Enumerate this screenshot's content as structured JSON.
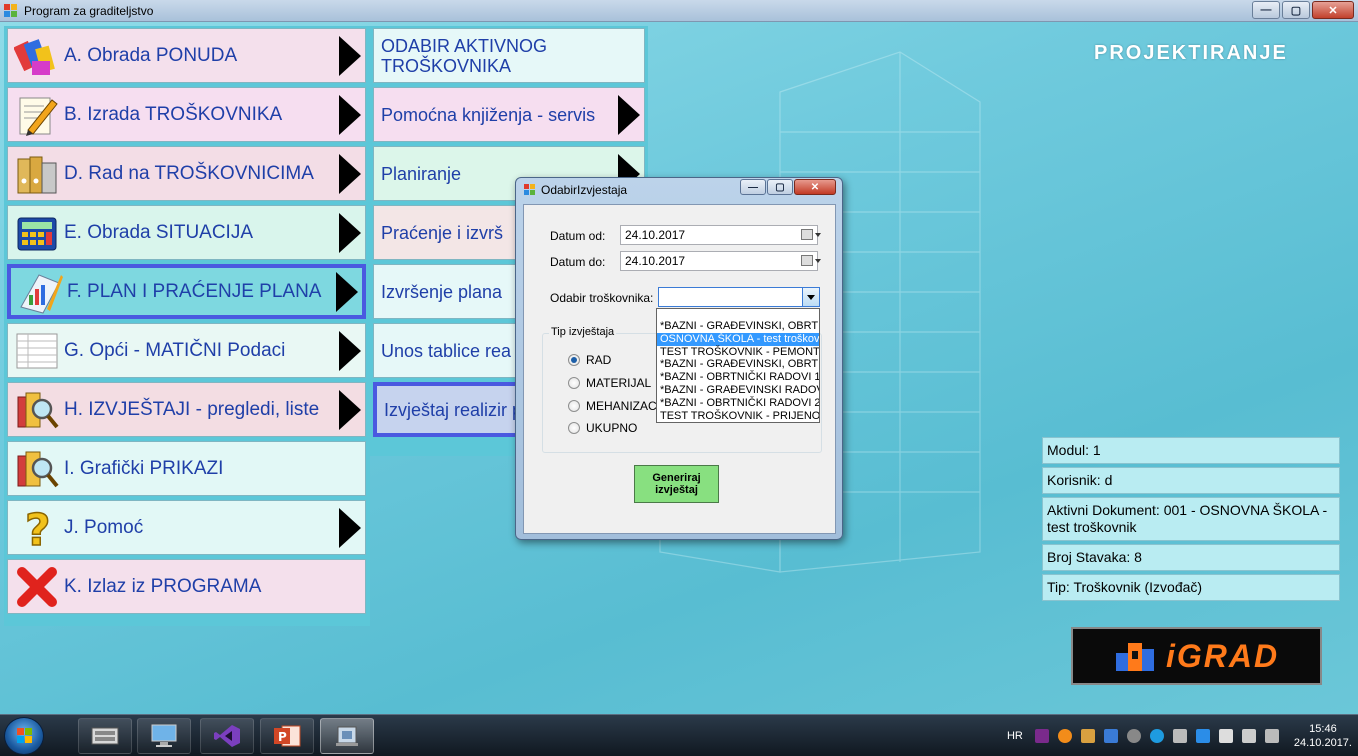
{
  "window": {
    "title": "Program za graditeljstvo"
  },
  "window_controls": {
    "minimize": "—",
    "maximize": "▢",
    "close": "✕"
  },
  "brand": {
    "header": "PROJEKTIRANJE",
    "logo": "iGRAD"
  },
  "left_menu": [
    {
      "label": "A. Obrada PONUDA",
      "icon": "colored-blocks-icon",
      "arrow": true
    },
    {
      "label": "B. Izrada TROŠKOVNIKA",
      "icon": "pencil-note-icon",
      "arrow": true
    },
    {
      "label": "D. Rad na TROŠKOVNICIMA",
      "icon": "binders-icon",
      "arrow": true
    },
    {
      "label": "E. Obrada SITUACIJA",
      "icon": "calculator-icon",
      "arrow": true
    },
    {
      "label": "F. PLAN I PRAĆENJE PLANA",
      "icon": "chart-pencil-icon",
      "arrow": true,
      "active": true
    },
    {
      "label": "G. Opći - MATIČNI Podaci",
      "icon": "list-sheet-icon",
      "arrow": true
    },
    {
      "label": "H. IZVJEŠTAJI - pregledi, liste",
      "icon": "magnifier-folder-icon",
      "arrow": true
    },
    {
      "label": "I. Grafički PRIKAZI",
      "icon": "magnifier-folder-icon",
      "arrow": false
    },
    {
      "label": "J. Pomoć",
      "icon": "question-mark-icon",
      "arrow": true
    },
    {
      "label": "K. Izlaz iz PROGRAMA",
      "icon": "red-x-icon",
      "arrow": false
    }
  ],
  "sub_menu": [
    {
      "label": "ODABIR AKTIVNOG TROŠKOVNIKA",
      "arrow": false
    },
    {
      "label": "Pomoćna knjiženja - servis",
      "arrow": true
    },
    {
      "label": "Planiranje",
      "arrow": true
    },
    {
      "label": "Praćenje i izvrš",
      "arrow": false
    },
    {
      "label": "Izvršenje plana",
      "arrow": false
    },
    {
      "label": "Unos tablice rea planirano",
      "arrow": false
    },
    {
      "label": "Izvještaj realizir planirano",
      "arrow": false,
      "active": true
    }
  ],
  "info_panel": {
    "modul": "Modul: 1",
    "korisnik": "Korisnik: d",
    "aktivni_dokument": "Aktivni Dokument: 001 - OSNOVNA ŠKOLA - test troškovnik",
    "broj_stavaka": "Broj Stavaka: 8",
    "tip": "Tip: Troškovnik (Izvođač)"
  },
  "dialog": {
    "title": "OdabirIzvjestaja",
    "datum_od_label": "Datum od:",
    "datum_od_value": "24.10.2017",
    "datum_do_label": "Datum do:",
    "datum_do_value": "24.10.2017",
    "troskovnik_label": "Odabir troškovnika:",
    "troskovnik_value": "",
    "dropdown_items": [
      "*BAZNI - GRAĐEVINSKI, OBRTN",
      "OSNOVNA ŠKOLA - test troškovn",
      "TEST TROŠKOVNIK - PEMONT",
      "*BAZNI - GRAĐEVINSKI, OBRTN",
      "*BAZNI - OBRTNIČKI RADOVI 1",
      "*BAZNI - GRAĐEVINSKI RADOV",
      "*BAZNI - OBRTNIČKI RADOVI 2",
      "TEST TROŠKOVNIK - PRIJENOS"
    ],
    "dropdown_selected_index": 1,
    "group_title": "Tip izvještaja",
    "radios": [
      {
        "label": "RAD",
        "checked": true
      },
      {
        "label": "MATERIJAL",
        "checked": false
      },
      {
        "label": "MEHANIZACIJ",
        "checked": false
      },
      {
        "label": "UKUPNO",
        "checked": false
      }
    ],
    "generate_button": "Generiraj izvještaj"
  },
  "taskbar": {
    "apps": [
      "keyboard-app-icon",
      "computer-app-icon",
      "visual-studio-icon",
      "powerpoint-icon",
      "igrad-app-icon"
    ],
    "active_app_index": 4,
    "language": "HR",
    "time": "15:46",
    "date": "24.10.2017."
  },
  "colors": {
    "button_text": "#1f3fa8",
    "active_border": "#4a59e0",
    "background": "#6fcadd",
    "logo_orange": "#ff7a1a"
  }
}
